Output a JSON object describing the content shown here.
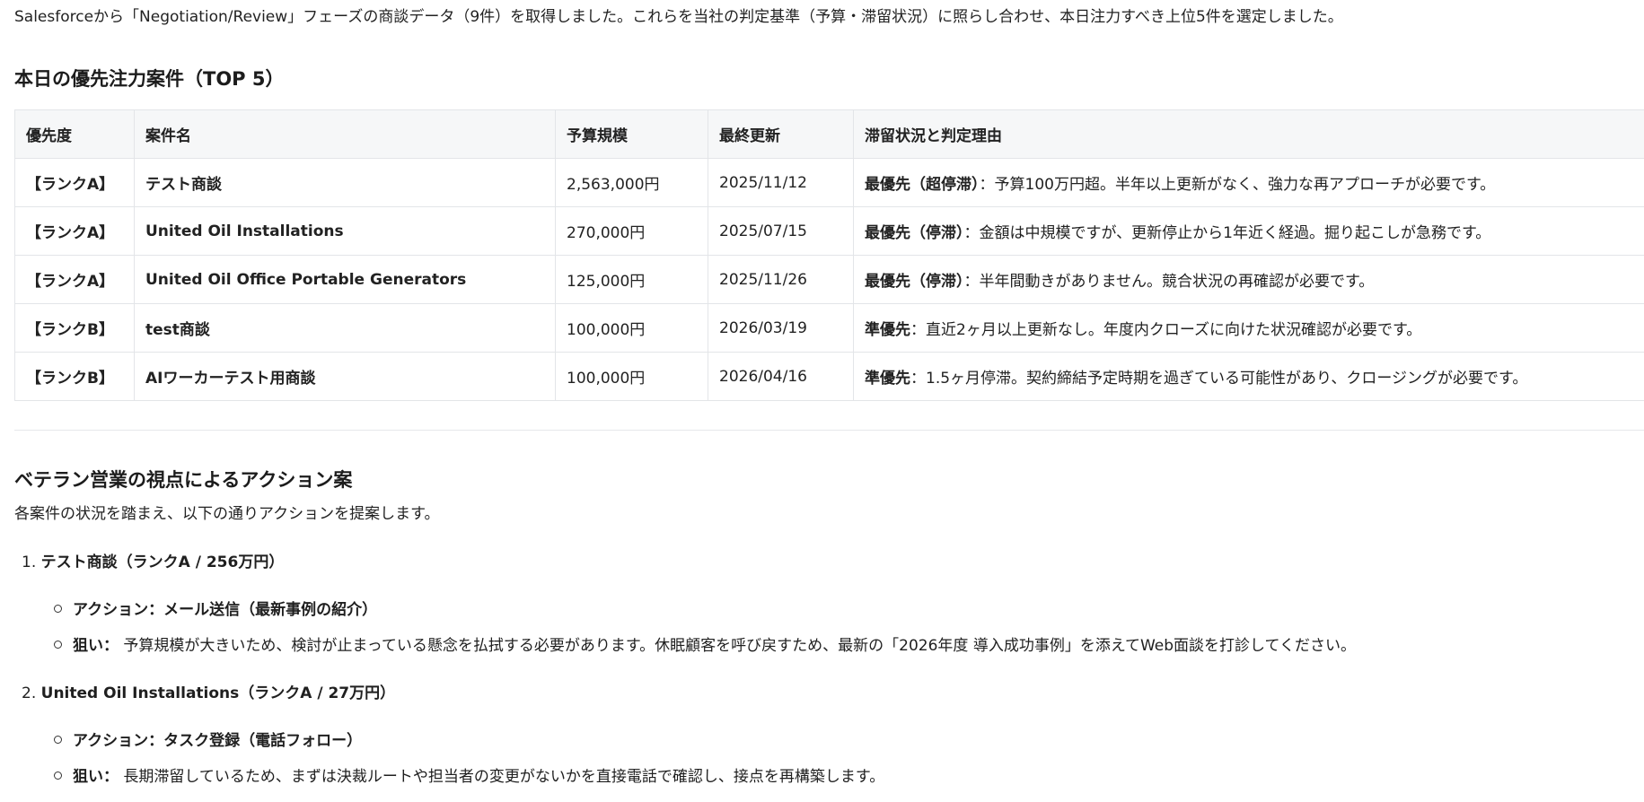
{
  "intro": "Salesforceから「Negotiation/Review」フェーズの商談データ（9件）を取得しました。これらを当社の判定基準（予算・滞留状況）に照らし合わせ、本日注力すべき上位5件を選定しました。",
  "top5": {
    "title": "本日の優先注力案件（TOP 5）",
    "headers": [
      "優先度",
      "案件名",
      "予算規模",
      "最終更新",
      "滞留状況と判定理由"
    ],
    "rows": [
      {
        "rank": "【ランクA】",
        "name": "テスト商談",
        "budget": "2,563,000円",
        "updated": "2025/11/12",
        "status_label": "最優先（超停滞）",
        "status_text": "：予算100万円超。半年以上更新がなく、強力な再アプローチが必要です。"
      },
      {
        "rank": "【ランクA】",
        "name": "United Oil Installations",
        "budget": "270,000円",
        "updated": "2025/07/15",
        "status_label": "最優先（停滞）",
        "status_text": "：金額は中規模ですが、更新停止から1年近く経過。掘り起こしが急務です。"
      },
      {
        "rank": "【ランクA】",
        "name": "United Oil Office Portable Generators",
        "budget": "125,000円",
        "updated": "2025/11/26",
        "status_label": "最優先（停滞）",
        "status_text": "：半年間動きがありません。競合状況の再確認が必要です。"
      },
      {
        "rank": "【ランクB】",
        "name": "test商談",
        "budget": "100,000円",
        "updated": "2026/03/19",
        "status_label": "準優先",
        "status_text": "：直近2ヶ月以上更新なし。年度内クローズに向けた状況確認が必要です。"
      },
      {
        "rank": "【ランクB】",
        "name": "AIワーカーテスト用商談",
        "budget": "100,000円",
        "updated": "2026/04/16",
        "status_label": "準優先",
        "status_text": "：1.5ヶ月停滞。契約締結予定時期を過ぎている可能性があり、クロージングが必要です。"
      }
    ]
  },
  "actions": {
    "title": "ベテラン営業の視点によるアクション案",
    "subtitle": "各案件の状況を踏まえ、以下の通りアクションを提案します。",
    "items": [
      {
        "num": "1.",
        "title": "テスト商談（ランクA / 256万円）",
        "action": "アクション：メール送信（最新事例の紹介）",
        "aim_label": "狙い：",
        "aim_text": " 予算規模が大きいため、検討が止まっている懸念を払拭する必要があります。休眠顧客を呼び戻すため、最新の「2026年度 導入成功事例」を添えてWeb面談を打診してください。"
      },
      {
        "num": "2.",
        "title": "United Oil Installations（ランクA / 27万円）",
        "action": "アクション：タスク登録（電話フォロー）",
        "aim_label": "狙い：",
        "aim_text": " 長期滞留しているため、まずは決裁ルートや担当者の変更がないかを直接電話で確認し、接点を再構築します。"
      }
    ]
  }
}
